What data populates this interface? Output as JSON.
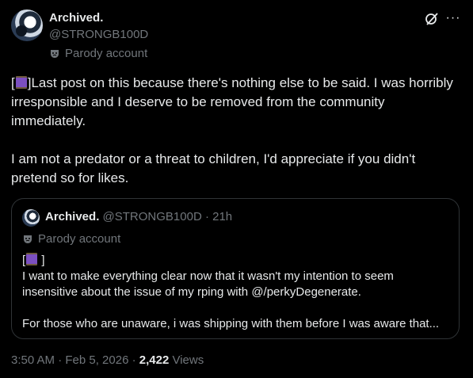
{
  "author": {
    "name": "Archived.",
    "handle": "@STRONGB100D",
    "badge": "Parody account"
  },
  "post": {
    "lines": [
      "]Last post on this because there's nothing else to be said. I was horribly irresponsible and I deserve to be removed from the community immediately.",
      "I am not a predator or a threat to children, I'd appreciate if you didn't pretend so for likes."
    ],
    "open_bracket": "["
  },
  "quote": {
    "name": "Archived.",
    "handle_time": "@STRONGB100D · 21h",
    "badge": "Parody account",
    "bracket_open": "[",
    "bracket_close": " ]",
    "line1": "I want to make everything clear now that it wasn't my intention to seem",
    "line2": "insensitive about the issue of my rping with @/perkyDegenerate.",
    "line3": "For those who are unaware, i was shipping with them before I was aware that..."
  },
  "footer": {
    "timestamp": "3:50 AM · Feb 5, 2026 · ",
    "views_count": "2,422",
    "views_label": " Views"
  },
  "icons": {
    "spool": "thread-spool-emoji",
    "mask": "theater-mask-icon",
    "grok": "grok-icon",
    "more": "more-icon"
  },
  "colors": {
    "background": "#000000",
    "text": "#e7e9ea",
    "muted": "#71767b",
    "border": "#2f3336",
    "spool_thread": "#7b4fc0"
  }
}
